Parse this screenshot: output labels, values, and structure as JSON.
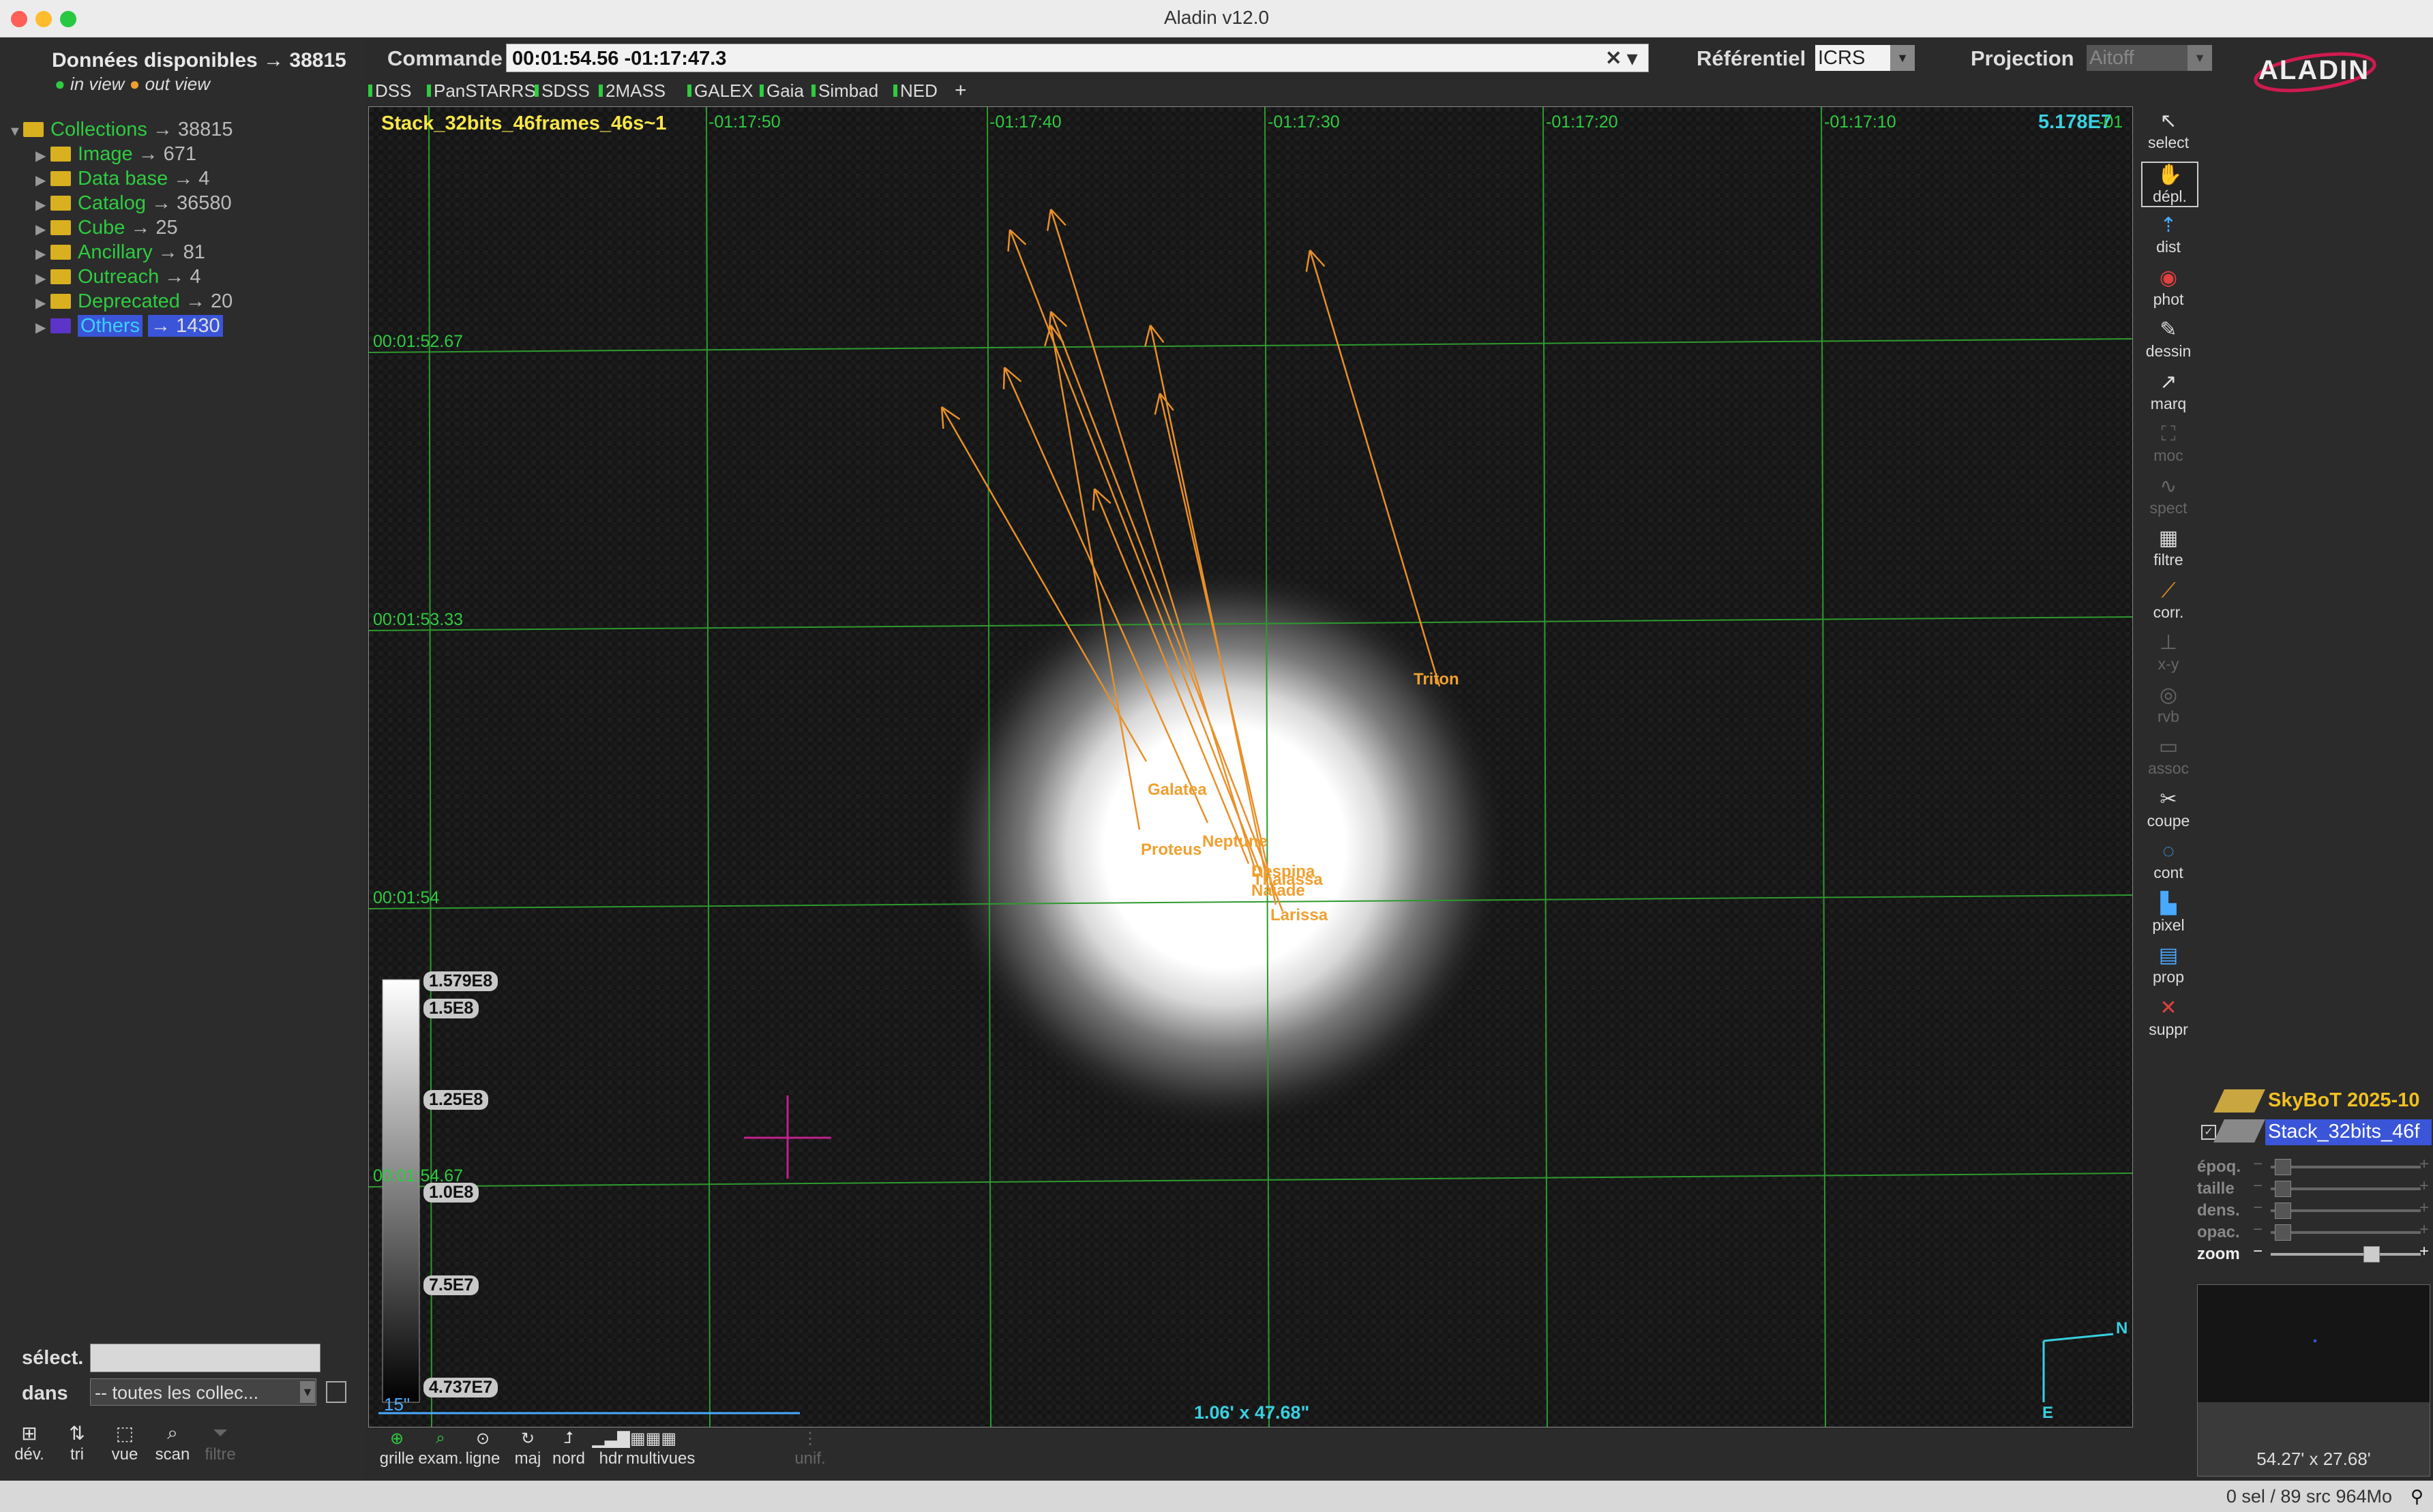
{
  "window": {
    "title": "Aladin v12.0"
  },
  "left": {
    "header": "Données disponibles → 38815",
    "legend_in": "in view",
    "legend_out": "out view",
    "tree": [
      {
        "label": "Collections",
        "count": "→ 38815",
        "color": "#2ecc40"
      },
      {
        "label": "Image",
        "count": "→ 671",
        "color": "#2ecc40"
      },
      {
        "label": "Data base",
        "count": "→ 4",
        "color": "#2ecc40"
      },
      {
        "label": "Catalog",
        "count": "→ 36580",
        "color": "#2ecc40"
      },
      {
        "label": "Cube",
        "count": "→ 25",
        "color": "#2ecc40"
      },
      {
        "label": "Ancillary",
        "count": "→ 81",
        "color": "#2ecc40"
      },
      {
        "label": "Outreach",
        "count": "→ 4",
        "color": "#2ecc40"
      },
      {
        "label": "Deprecated",
        "count": "→ 20",
        "color": "#2ecc40"
      },
      {
        "label": "Others",
        "count": "→ 1430",
        "color": "#3ad0ff"
      }
    ],
    "select_label": "sélect.",
    "in_label": "dans",
    "in_value": "-- toutes les collec...",
    "bottom_buttons": [
      "dév.",
      "tri",
      "vue",
      "scan",
      "filtre"
    ]
  },
  "command": {
    "label": "Commande",
    "value": "00:01:54.56 -01:17:47.3",
    "ref_label": "Référentiel",
    "ref_value": "ICRS",
    "proj_label": "Projection",
    "proj_value": "Aitoff"
  },
  "surveys": [
    "DSS",
    "PanSTARRS",
    "SDSS",
    "2MASS",
    "GALEX",
    "Gaia",
    "Simbad",
    "NED",
    "+"
  ],
  "view": {
    "image_label": "Stack_32bits_46frames_46s~1",
    "pixel_value": "5.178E7",
    "ra_ticks": [
      "-01:17:50",
      "-01:17:40",
      "-01:17:30",
      "-01:17:20",
      "-01:17:10",
      "-01"
    ],
    "dec_ticks": [
      "00:01:52.67",
      "00:01:53.33",
      "00:01:54",
      "00:01:54.67"
    ],
    "objects": [
      "Triton",
      "Galatea",
      "Proteus",
      "Neptune",
      "Despina",
      "Thalassa",
      "Naiade",
      "Larissa"
    ],
    "colorbar": [
      "1.579E8",
      "1.5E8",
      "1.25E8",
      "1.0E8",
      "7.5E7",
      "4.737E7"
    ],
    "scale": "15\"",
    "fov": "1.06' x 47.68\"",
    "north": "N",
    "east": "E"
  },
  "tools": [
    "select",
    "dépl.",
    "dist",
    "phot",
    "dessin",
    "marq",
    "moc",
    "spect",
    "filtre",
    "corr.",
    "x-y",
    "rvb",
    "assoc",
    "coupe",
    "cont",
    "pixel",
    "prop",
    "suppr"
  ],
  "planes": [
    "SkyBoT 2025-10",
    "Stack_32bits_46f"
  ],
  "sliders": [
    "époq.",
    "taille",
    "dens.",
    "opac.",
    "zoom"
  ],
  "overview": {
    "size": "54.27' x 27.68'"
  },
  "bottom_tools": [
    "grille",
    "exam.",
    "ligne",
    "maj",
    "nord",
    "hdr",
    "multivues",
    "unif."
  ],
  "status": {
    "text": "0 sel / 89 src    964Mo"
  },
  "colors": {
    "accent": "#2ecc40",
    "selection": "#3a55d8",
    "marker": "#f0a030"
  }
}
